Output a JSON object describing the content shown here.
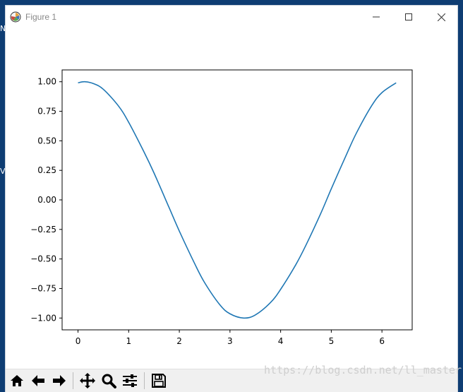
{
  "window": {
    "title": "Figure 1"
  },
  "desktop": {
    "fragment_top": "N",
    "fragment_mid": "V"
  },
  "watermark": "https://blog.csdn.net/ll_master",
  "toolbar": {
    "buttons": [
      {
        "name": "home",
        "icon": "home-icon"
      },
      {
        "name": "back",
        "icon": "arrow-left-icon"
      },
      {
        "name": "forward",
        "icon": "arrow-right-icon"
      },
      {
        "name": "pan",
        "icon": "move-icon"
      },
      {
        "name": "zoom",
        "icon": "magnifier-icon"
      },
      {
        "name": "subplots",
        "icon": "sliders-icon"
      },
      {
        "name": "save",
        "icon": "floppy-disk-icon"
      }
    ]
  },
  "chart_data": {
    "type": "line",
    "title": "",
    "xlabel": "",
    "ylabel": "",
    "xlim": [
      -0.314,
      6.597
    ],
    "ylim": [
      -1.1,
      1.1
    ],
    "x_ticks": [
      0,
      1,
      2,
      3,
      4,
      5,
      6
    ],
    "x_tick_labels": [
      "0",
      "1",
      "2",
      "3",
      "4",
      "5",
      "6"
    ],
    "y_ticks": [
      1.0,
      0.75,
      0.5,
      0.25,
      0.0,
      -0.25,
      -0.5,
      -0.75,
      -1.0
    ],
    "y_tick_labels": [
      "1.00",
      "0.75",
      "0.50",
      "0.25",
      "0.00",
      "−0.25",
      "−0.50",
      "−0.75",
      "−1.00"
    ],
    "grid": false,
    "line_color": "#1f77b4",
    "series": [
      {
        "x": [
          0.0,
          0.13,
          0.3,
          0.5,
          0.8,
          1.0,
          1.3,
          1.5,
          1.8,
          2.0,
          2.3,
          2.5,
          2.8,
          3.0,
          3.27,
          3.5,
          3.8,
          4.0,
          4.3,
          4.5,
          4.8,
          5.0,
          5.3,
          5.5,
          5.8,
          6.0,
          6.28
        ],
        "y": [
          0.991,
          1.0,
          0.985,
          0.936,
          0.794,
          0.657,
          0.408,
          0.228,
          -0.067,
          -0.264,
          -0.537,
          -0.701,
          -0.888,
          -0.964,
          -1.0,
          -0.974,
          -0.869,
          -0.757,
          -0.548,
          -0.383,
          -0.107,
          0.094,
          0.384,
          0.569,
          0.799,
          0.908,
          0.991
        ]
      }
    ]
  }
}
